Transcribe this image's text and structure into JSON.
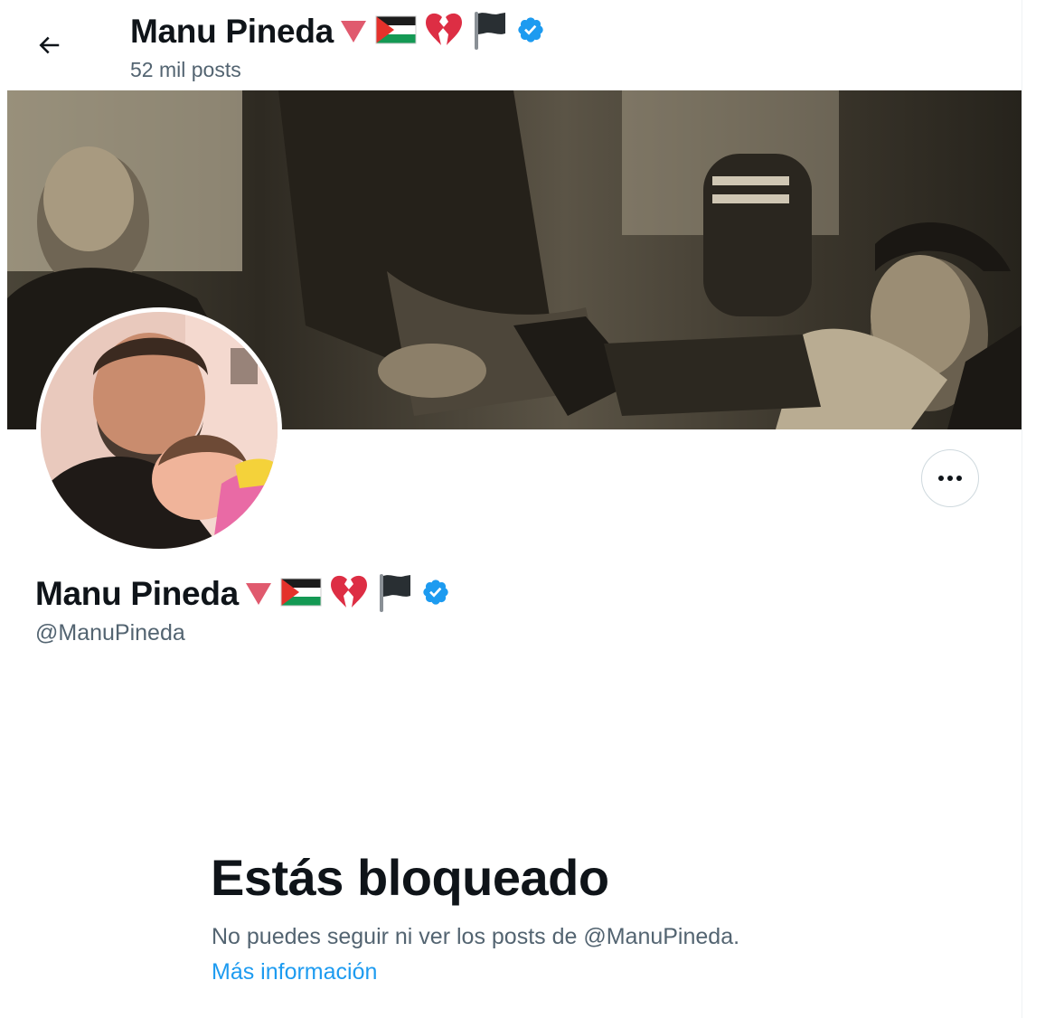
{
  "header": {
    "name": "Manu Pineda",
    "posts_count": "52 mil posts",
    "back_icon": "arrow-left-icon"
  },
  "name_emojis": [
    "triangle-down",
    "palestine-flag",
    "broken-heart",
    "black-flag",
    "verified-badge"
  ],
  "banner": {
    "description": "sepia-photo"
  },
  "profile": {
    "name": "Manu Pineda",
    "handle": "@ManuPineda",
    "more_icon": "more-horizontal-icon"
  },
  "blocked": {
    "title": "Estás bloqueado",
    "message": "No puedes seguir ni ver los posts de @ManuPineda.",
    "link": "Más información"
  },
  "colors": {
    "text_primary": "#0f1419",
    "text_secondary": "#536471",
    "link": "#1d9bf0",
    "verified": "#1d9bf0",
    "triangle": "#e05a6e",
    "heart": "#dd2e44"
  }
}
